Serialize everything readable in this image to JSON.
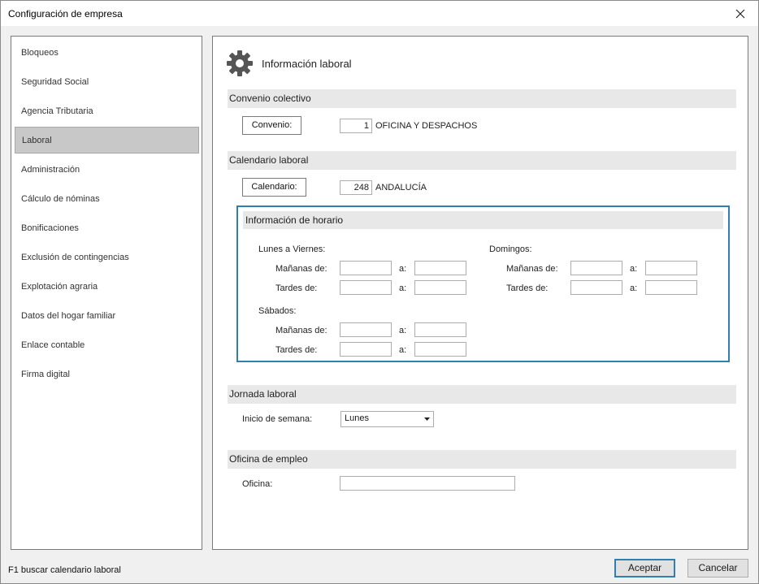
{
  "window": {
    "title": "Configuración de empresa"
  },
  "sidebar": {
    "items": [
      {
        "label": "Bloqueos"
      },
      {
        "label": "Seguridad Social"
      },
      {
        "label": "Agencia Tributaria"
      },
      {
        "label": "Laboral",
        "active": true
      },
      {
        "label": "Administración"
      },
      {
        "label": "Cálculo de nóminas"
      },
      {
        "label": "Bonificaciones"
      },
      {
        "label": "Exclusión de contingencias"
      },
      {
        "label": "Explotación agraria"
      },
      {
        "label": "Datos del hogar familiar"
      },
      {
        "label": "Enlace contable"
      },
      {
        "label": "Firma digital"
      }
    ]
  },
  "main": {
    "title": "Información laboral",
    "convenio": {
      "section": "Convenio colectivo",
      "button": "Convenio:",
      "code": "1",
      "name": "OFICINA Y DESPACHOS"
    },
    "calendario": {
      "section": "Calendario laboral",
      "button": "Calendario:",
      "code": "248",
      "name": "ANDALUCÍA"
    },
    "horario": {
      "section": "Información de horario",
      "weekdays_label": "Lunes a Viernes:",
      "sundays_label": "Domingos:",
      "saturdays_label": "Sábados:",
      "mornings_label": "Mañanas de:",
      "afternoons_label": "Tardes de:",
      "to_label": "a:"
    },
    "jornada": {
      "section": "Jornada laboral",
      "week_start_label": "Inicio de semana:",
      "week_start_value": "Lunes"
    },
    "oficina": {
      "section": "Oficina de empleo",
      "label": "Oficina:",
      "value": ""
    }
  },
  "footer": {
    "status": "F1 buscar calendario laboral",
    "accept": "Aceptar",
    "cancel": "Cancelar"
  },
  "colors": {
    "accent": "#2f7fb0",
    "section_bg": "#e8e8e8",
    "active_item_bg": "#c8c8c8"
  }
}
